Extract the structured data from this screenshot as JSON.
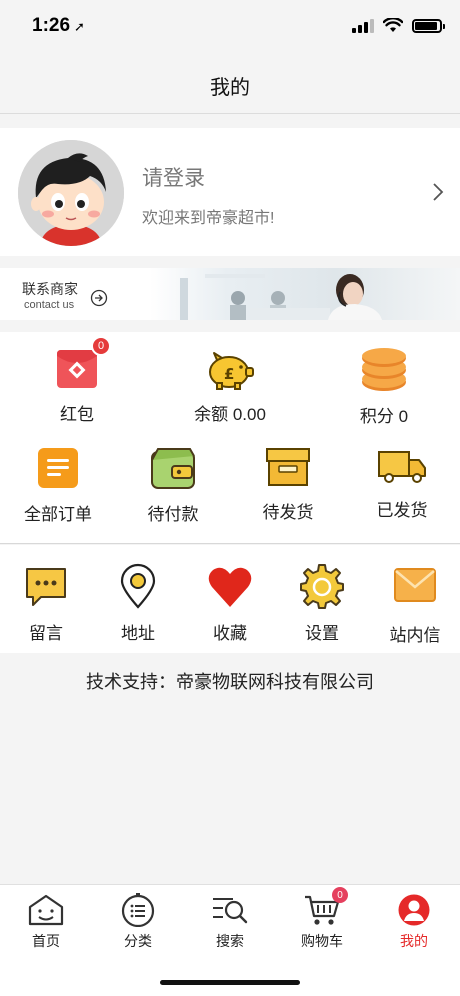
{
  "status": {
    "time": "1:26",
    "location_icon": "location-arrow-icon"
  },
  "nav": {
    "title": "我的"
  },
  "profile": {
    "login": "请登录",
    "welcome": "欢迎来到帝豪超市!"
  },
  "banner": {
    "title": "联系商家",
    "subtitle": "contact us"
  },
  "wallet": [
    {
      "label": "红包",
      "icon": "red-envelope-icon",
      "badge": "0"
    },
    {
      "label": "余额 0.00",
      "icon": "piggy-bank-icon"
    },
    {
      "label": "积分 0",
      "icon": "coin-stack-icon"
    }
  ],
  "orders": [
    {
      "label": "全部订单",
      "icon": "order-list-icon"
    },
    {
      "label": "待付款",
      "icon": "wallet-icon"
    },
    {
      "label": "待发货",
      "icon": "package-box-icon"
    },
    {
      "label": "已发货",
      "icon": "delivery-truck-icon"
    }
  ],
  "tools": [
    {
      "label": "留言",
      "icon": "message-icon"
    },
    {
      "label": "地址",
      "icon": "location-pin-icon"
    },
    {
      "label": "收藏",
      "icon": "heart-icon"
    },
    {
      "label": "设置",
      "icon": "gear-icon"
    },
    {
      "label": "站内信",
      "icon": "envelope-icon"
    }
  ],
  "footer": {
    "text": "技术支持：帝豪物联网科技有限公司"
  },
  "tabbar": [
    {
      "label": "首页",
      "icon": "home-face-icon"
    },
    {
      "label": "分类",
      "icon": "category-icon"
    },
    {
      "label": "搜索",
      "icon": "search-icon"
    },
    {
      "label": "购物车",
      "icon": "cart-icon",
      "badge": "0"
    },
    {
      "label": "我的",
      "icon": "profile-icon",
      "active": true
    }
  ],
  "colors": {
    "accent": "#e52929",
    "orange": "#f59b1a",
    "yellow": "#f3c93b",
    "badge": "#e5405e"
  }
}
